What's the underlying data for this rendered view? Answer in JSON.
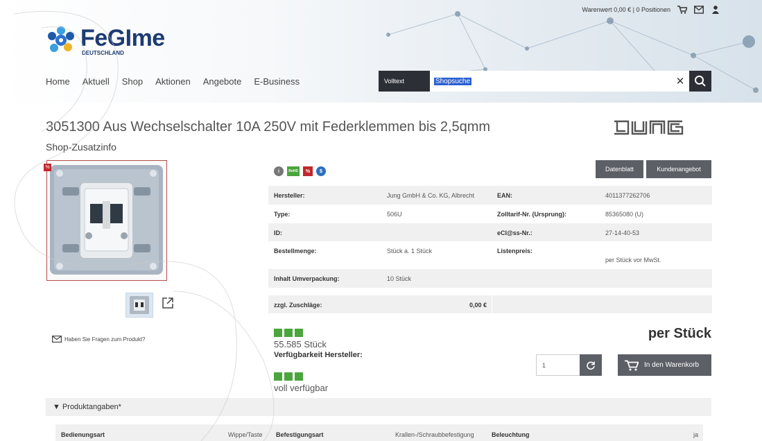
{
  "header": {
    "cart_summary": "Warenwert 0,00 € | 0 Positionen",
    "logo_name": "FeGIme",
    "logo_sub": "DEUTSCHLAND",
    "nav": [
      "Home",
      "Aktuell",
      "Shop",
      "Aktionen",
      "Angebote",
      "E-Business"
    ],
    "search_mode": "Volltext",
    "search_value": "Shopsuche"
  },
  "product": {
    "title": "3051300 Aus Wechselschalter 10A 250V mit Federklemmen bis 2,5qmm",
    "subtitle": "Shop-Zusatzinfo",
    "brand": "JUNG",
    "question": "Haben Sie Fragen zum Produkt?",
    "datasheet_label": "Datenblatt",
    "offer_label": "Kundenangebot",
    "specs": [
      {
        "k1": "Hersteller:",
        "v1": "Jung GmbH & Co. KG, Albrecht",
        "k2": "EAN:",
        "v2": "4011377262706"
      },
      {
        "k1": "Type:",
        "v1": "506U",
        "k2": "Zolltarif-Nr. (Ursprung):",
        "v2": "85365080 (U)"
      },
      {
        "k1": "ID:",
        "v1": "",
        "k2": "eCl@ss-Nr.:",
        "v2": "27-14-40-53"
      },
      {
        "k1": "Bestellmenge:",
        "v1": "Stück a. 1 Stück",
        "k2": "Listenpreis:",
        "v2": "per Stück vor MwSt."
      },
      {
        "k1": "Inhalt Umverpackung:",
        "v1": "10 Stück",
        "k2": "",
        "v2": ""
      }
    ],
    "surcharge_label": "zzgl. Zuschläge:",
    "surcharge_value": "0,00 €",
    "stock_qty": "55.585 Stück",
    "stock_label": "Verfügbarkeit Hersteller:",
    "stock_status": "voll verfügbar",
    "price_unit": "per Stück",
    "quantity": "1",
    "cart_button": "In den Warenkorb"
  },
  "details": {
    "accordion_label": "▼ Produktangaben*",
    "row": [
      {
        "k": "Bedienungsart",
        "v": "Wippe/Taste"
      },
      {
        "k": "Befestigungsart",
        "v": "Krallen-/Schraubbefestigung"
      },
      {
        "k": "Beleuchtung",
        "v": "ja"
      }
    ]
  },
  "colors": {
    "brand_blue": "#1d3b73",
    "dark_button": "#5c5f66",
    "stock_green": "#4aa53c",
    "badge_red": "#c0282d"
  }
}
